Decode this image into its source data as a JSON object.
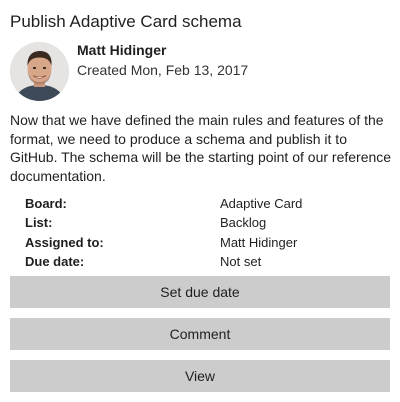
{
  "card": {
    "title": "Publish Adaptive Card schema",
    "author": {
      "name": "Matt Hidinger",
      "created": "Created Mon, Feb 13, 2017",
      "avatar_icon": "person-avatar-icon"
    },
    "description": "Now that we have defined the main rules and features of the format, we need to produce a schema and publish it to GitHub. The schema will be the starting point of our reference documentation.",
    "facts": [
      {
        "key": "Board:",
        "value": "Adaptive Card"
      },
      {
        "key": "List:",
        "value": "Backlog"
      },
      {
        "key": "Assigned to:",
        "value": "Matt Hidinger"
      },
      {
        "key": "Due date:",
        "value": "Not set"
      }
    ],
    "actions": [
      {
        "label": "Set due date"
      },
      {
        "label": "Comment"
      },
      {
        "label": "View"
      }
    ]
  },
  "colors": {
    "button_background": "#cccccc",
    "text": "#1f1f1f",
    "background": "#ffffff"
  }
}
